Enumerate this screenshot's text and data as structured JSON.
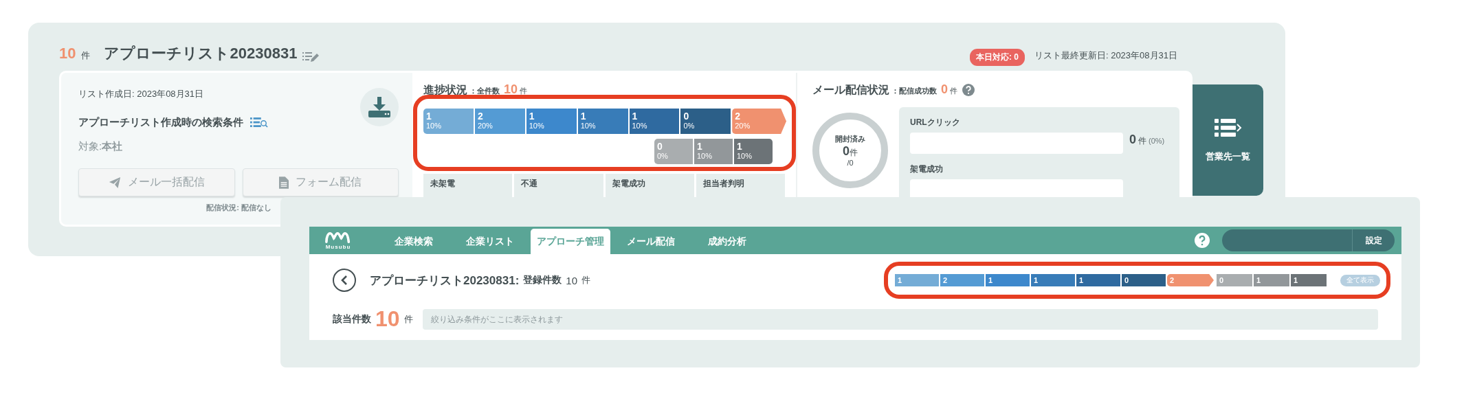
{
  "list_card": {
    "count": "10",
    "count_unit": "件",
    "title": "アプローチリスト20230831",
    "today_badge": "本日対応: 0",
    "last_updated": "リスト最終更新日: 2023年08月31日",
    "info": {
      "created": "リスト作成日: 2023年08月31日",
      "conditions_heading": "アプローチリスト作成時の検索条件",
      "target_label": "対象:",
      "target_value": "本社",
      "buttons": [
        {
          "label": "メール一括配信",
          "kind": "mail",
          "disabled": true
        },
        {
          "label": "フォーム配信",
          "kind": "form",
          "disabled": true
        }
      ],
      "delivery_status": "配信状況: 配信なし"
    },
    "progress": {
      "title": "進捗状況",
      "total_label": "：全件数",
      "total": "10",
      "total_unit": "件",
      "segments": [
        {
          "count": "1",
          "percent": "10%",
          "color": "#74acd6",
          "kind": "main"
        },
        {
          "count": "2",
          "percent": "20%",
          "color": "#549bd4",
          "kind": "main"
        },
        {
          "count": "1",
          "percent": "10%",
          "color": "#3d88cc",
          "kind": "main"
        },
        {
          "count": "1",
          "percent": "10%",
          "color": "#387cb8",
          "kind": "main"
        },
        {
          "count": "1",
          "percent": "10%",
          "color": "#2f6aa0",
          "kind": "main"
        },
        {
          "count": "0",
          "percent": "0%",
          "color": "#2c5f88",
          "kind": "main"
        },
        {
          "count": "2",
          "percent": "20%",
          "color": "#f0916f",
          "kind": "goal"
        },
        {
          "count": "0",
          "percent": "0%",
          "color": "#a9adaf",
          "kind": "sub"
        },
        {
          "count": "1",
          "percent": "10%",
          "color": "#92979a",
          "kind": "sub"
        },
        {
          "count": "1",
          "percent": "10%",
          "color": "#6c7377",
          "kind": "sub"
        }
      ],
      "columns": [
        "未架電",
        "不通",
        "架電成功",
        "担当者判明"
      ]
    },
    "mail": {
      "title": "メール配信状況",
      "success_label": "：配信成功数",
      "success": "0",
      "success_unit": "件",
      "opened_label": "開封済み",
      "opened": "0",
      "opened_unit": "件",
      "opened_total": "/0",
      "metrics": [
        {
          "label": "URLクリック",
          "value": "0",
          "unit": "件",
          "percent": "(0%)"
        },
        {
          "label": "架電成功"
        }
      ]
    },
    "side_button": "営業先一覧"
  },
  "app_window": {
    "logo": "Musubu",
    "tabs": [
      {
        "label": "企業検索",
        "selected": false
      },
      {
        "label": "企業リスト",
        "selected": false
      },
      {
        "label": "アプローチ管理",
        "selected": true
      },
      {
        "label": "メール配信",
        "selected": false
      },
      {
        "label": "成約分析",
        "selected": false
      }
    ],
    "settings": "設定",
    "title": "アプローチリスト20230831:",
    "registered_label": "登録件数",
    "registered": "10",
    "registered_unit": "件",
    "mini_bar": {
      "segments": [
        {
          "count": "1",
          "color": "#74acd6",
          "kind": "main"
        },
        {
          "count": "2",
          "color": "#549bd4",
          "kind": "main"
        },
        {
          "count": "1",
          "color": "#3d88cc",
          "kind": "main"
        },
        {
          "count": "1",
          "color": "#387cb8",
          "kind": "main"
        },
        {
          "count": "1",
          "color": "#2f6aa0",
          "kind": "main"
        },
        {
          "count": "0",
          "color": "#2c5f88",
          "kind": "main"
        },
        {
          "count": "2",
          "color": "#f0916f",
          "kind": "goal"
        },
        {
          "count": "0",
          "color": "#a9adaf",
          "kind": "sub"
        },
        {
          "count": "1",
          "color": "#92979a",
          "kind": "sub"
        },
        {
          "count": "1",
          "color": "#6c7377",
          "kind": "sub"
        }
      ],
      "show_all": "全て表示"
    },
    "match_label": "該当件数",
    "match_count": "10",
    "match_unit": "件",
    "filter_placeholder": "絞り込み条件がここに表示されます"
  }
}
